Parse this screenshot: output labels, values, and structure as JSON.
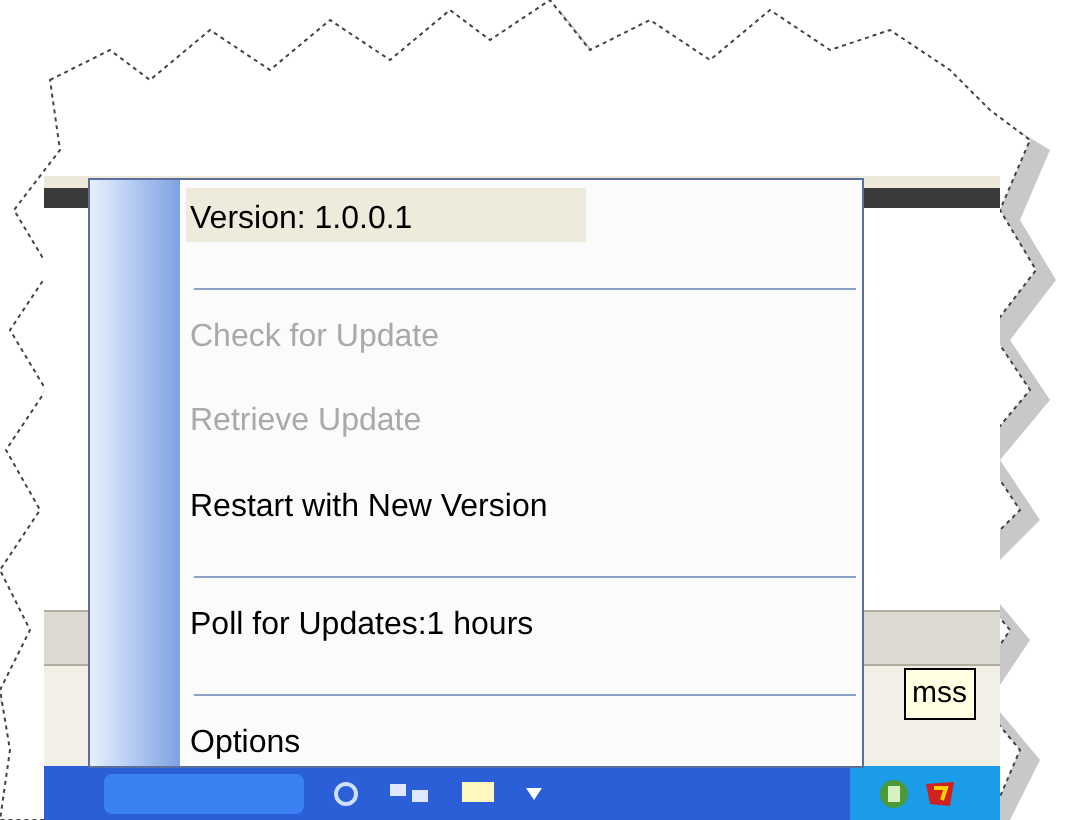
{
  "menu": {
    "items": [
      {
        "kind": "item",
        "label": "Version: 1.0.0.1",
        "disabled": false,
        "selected": true
      },
      {
        "kind": "separator"
      },
      {
        "kind": "item",
        "label": "Check for Update",
        "disabled": true,
        "selected": false
      },
      {
        "kind": "item",
        "label": "Retrieve Update",
        "disabled": true,
        "selected": false
      },
      {
        "kind": "item",
        "label": "Restart with New Version",
        "disabled": false,
        "selected": false
      },
      {
        "kind": "separator"
      },
      {
        "kind": "item",
        "label": "Poll for Updates:1 hours",
        "disabled": false,
        "selected": false
      },
      {
        "kind": "separator"
      },
      {
        "kind": "item",
        "label": "Options",
        "disabled": false,
        "selected": false
      }
    ]
  },
  "tooltip": {
    "text": "mss"
  }
}
